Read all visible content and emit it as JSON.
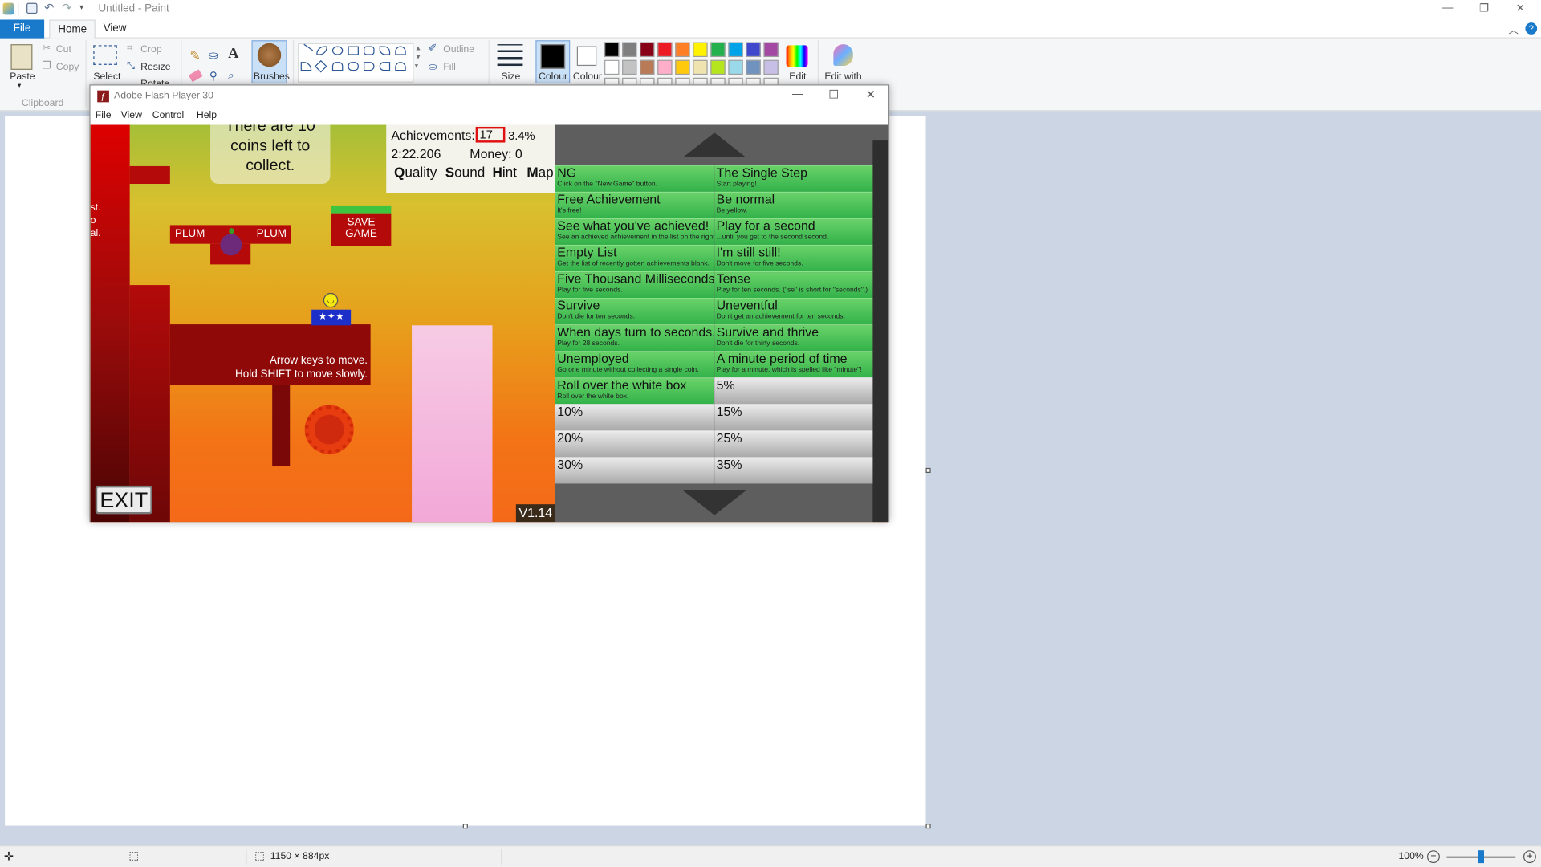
{
  "app": {
    "title": "Untitled - Paint"
  },
  "tabs": {
    "file": "File",
    "home": "Home",
    "view": "View"
  },
  "ribbon": {
    "paste": "Paste",
    "cut": "Cut",
    "copy": "Copy",
    "clipboard": "Clipboard",
    "select": "Select",
    "crop": "Crop",
    "resize": "Resize",
    "rotate": "Rotate",
    "brushes": "Brushes",
    "outline": "Outline",
    "fill": "Fill",
    "size": "Size",
    "colour1": "Colour",
    "colour2": "Colour",
    "edit_colours": "Edit",
    "edit_with": "Edit with"
  },
  "palette": [
    "#000000",
    "#7f7f7f",
    "#880015",
    "#ed1c24",
    "#ff7f27",
    "#fff200",
    "#22b14c",
    "#00a2e8",
    "#3f48cc",
    "#a349a4",
    "#ffffff",
    "#c3c3c3",
    "#b97a57",
    "#ffaec9",
    "#ffc90e",
    "#efe4b0",
    "#b5e61d",
    "#99d9ea",
    "#7092be",
    "#c8bfe7"
  ],
  "flash": {
    "title": "Adobe Flash Player 30",
    "menu": [
      "File",
      "View",
      "Control",
      "Help"
    ],
    "coins_text": "There are 10 coins left to collect.",
    "side_text": "st.\no\nal.",
    "plum_left": "PLUM",
    "plum_right": "PLUM",
    "save_game": "SAVE\nGAME",
    "instructions": "Arrow keys to move.\nHold SHIFT to move slowly.",
    "exit": "EXIT",
    "version": "V1.14",
    "achievements_label": "Achievements:",
    "achievements_count": "17",
    "achievements_pct": "3.4%",
    "timer": "2:22.206",
    "money_label": "Money: 0",
    "options": [
      {
        "key": "Q",
        "rest": "uality"
      },
      {
        "key": "S",
        "rest": "ound"
      },
      {
        "key": "H",
        "rest": "int"
      },
      {
        "key": "M",
        "rest": "ap"
      }
    ],
    "achievements": [
      {
        "name": "NG",
        "desc": "Click on the \"New Game\" button.",
        "done": true
      },
      {
        "name": "The Single Step",
        "desc": "Start playing!",
        "done": true
      },
      {
        "name": "Free Achievement",
        "desc": "It's free!",
        "done": true
      },
      {
        "name": "Be normal",
        "desc": "Be yellow.",
        "done": true
      },
      {
        "name": "See what you've achieved!",
        "desc": "See an achieved achievement in the list on the right.",
        "done": true
      },
      {
        "name": "Play for a second",
        "desc": "...until you get to the second second.",
        "done": true
      },
      {
        "name": "Empty List",
        "desc": "Get the list of recently gotten achievements blank.",
        "done": true
      },
      {
        "name": "I'm still still!",
        "desc": "Don't move for five seconds.",
        "done": true
      },
      {
        "name": "Five Thousand Milliseconds",
        "desc": "Play for five seconds.",
        "done": true
      },
      {
        "name": "Tense",
        "desc": "Play for ten seconds. (\"se\" is short for \"seconds\".)",
        "done": true
      },
      {
        "name": "Survive",
        "desc": "Don't die for ten seconds.",
        "done": true
      },
      {
        "name": "Uneventful",
        "desc": "Don't get an achievement for ten seconds.",
        "done": true
      },
      {
        "name": "When days turn to seconds...",
        "desc": "Play for 28 seconds.",
        "done": true
      },
      {
        "name": "Survive and thrive",
        "desc": "Don't die for thirty seconds.",
        "done": true
      },
      {
        "name": "Unemployed",
        "desc": "Go one minute without collecting a single coin.",
        "done": true
      },
      {
        "name": "A minute period of time",
        "desc": "Play for a minute, which is spelled like \"minute\"!",
        "done": true
      },
      {
        "name": "Roll over the white box",
        "desc": "Roll over the white box.",
        "done": true
      },
      {
        "name": "5%",
        "desc": "",
        "done": false
      },
      {
        "name": "10%",
        "desc": "",
        "done": false
      },
      {
        "name": "15%",
        "desc": "",
        "done": false
      },
      {
        "name": "20%",
        "desc": "",
        "done": false
      },
      {
        "name": "25%",
        "desc": "",
        "done": false
      },
      {
        "name": "30%",
        "desc": "",
        "done": false
      },
      {
        "name": "35%",
        "desc": "",
        "done": false
      }
    ]
  },
  "status": {
    "dimensions": "1150 × 884px",
    "zoom": "100%",
    "zoom_level": 0.5
  }
}
